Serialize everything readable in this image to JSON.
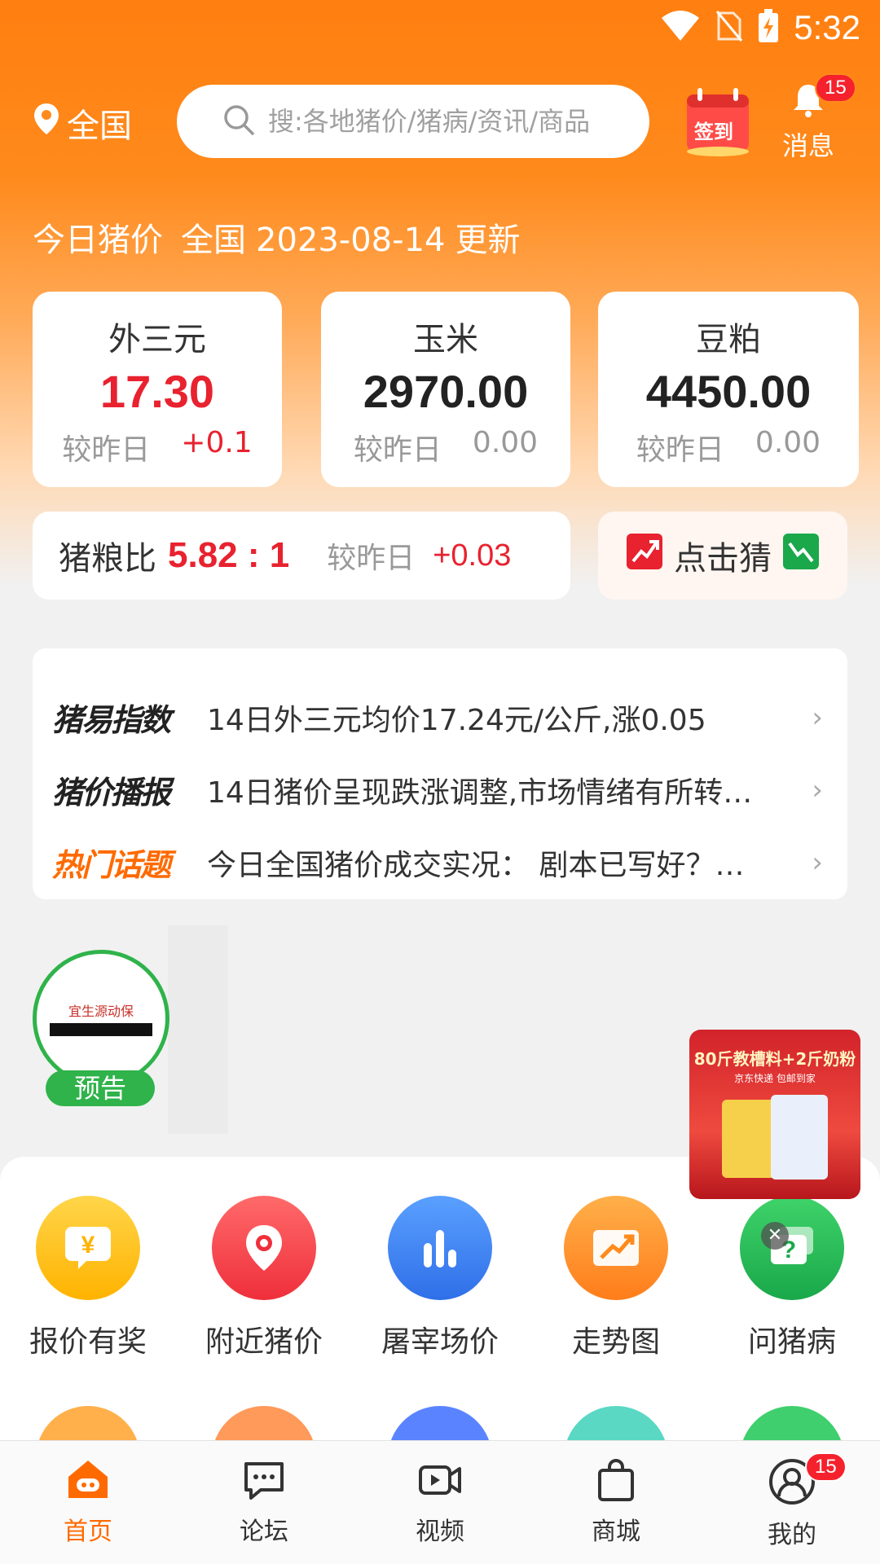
{
  "status_bar": {
    "time": "5:32"
  },
  "header": {
    "location": "全国",
    "search_placeholder": "搜:各地猪价/猪病/资讯/商品",
    "signin_label": "签到",
    "message_label": "消息",
    "message_badge": "15"
  },
  "today": {
    "title": "今日猪价",
    "region": "全国",
    "date": "2023-08-14",
    "suffix": "更新"
  },
  "prices": [
    {
      "name": "外三元",
      "value": "17.30",
      "compare_label": "较昨日",
      "delta": "+0.1"
    },
    {
      "name": "玉米",
      "value": "2970.00",
      "compare_label": "较昨日",
      "delta": "0.00"
    },
    {
      "name": "豆粕",
      "value": "4450.00",
      "compare_label": "较昨日",
      "delta": "0.00"
    }
  ],
  "ratio": {
    "label": "猪粮比",
    "value": "5.82 : 1",
    "compare_label": "较昨日",
    "delta": "+0.03"
  },
  "guess": {
    "label": "点击猜"
  },
  "news": [
    {
      "tag": "猪易指数",
      "text": "14日外三元均价17.24元/公斤,涨0.05"
    },
    {
      "tag": "猪价播报",
      "text": "14日猪价呈现跌涨调整,市场情绪有所转…"
    },
    {
      "tag": "热门话题",
      "text": "今日全国猪价成交实况： 剧本已写好？…"
    }
  ],
  "live": {
    "tag": "预告",
    "logo_text": "宜生源动保"
  },
  "ad": {
    "title": "80斤教槽料+2斤奶粉",
    "subtitle": "京东快递 包邮到家"
  },
  "menu": [
    {
      "label": "报价有奖",
      "icon": "yuan-chat-icon",
      "color": "#ffc21a"
    },
    {
      "label": "附近猪价",
      "icon": "location-pin-icon",
      "color": "#f2444b"
    },
    {
      "label": "屠宰场价",
      "icon": "bar-chart-icon",
      "color": "#3f86f5"
    },
    {
      "label": "走势图",
      "icon": "trend-up-icon",
      "color": "#ff9a2a"
    },
    {
      "label": "问猪病",
      "icon": "question-chat-icon",
      "color": "#2fc05a"
    }
  ],
  "tabs": [
    {
      "label": "首页",
      "icon": "home-pig-icon",
      "active": true
    },
    {
      "label": "论坛",
      "icon": "chat-bubble-icon",
      "active": false
    },
    {
      "label": "视频",
      "icon": "video-icon",
      "active": false
    },
    {
      "label": "商城",
      "icon": "shopping-bag-icon",
      "active": false
    },
    {
      "label": "我的",
      "icon": "user-icon",
      "active": false,
      "badge": "15"
    }
  ]
}
